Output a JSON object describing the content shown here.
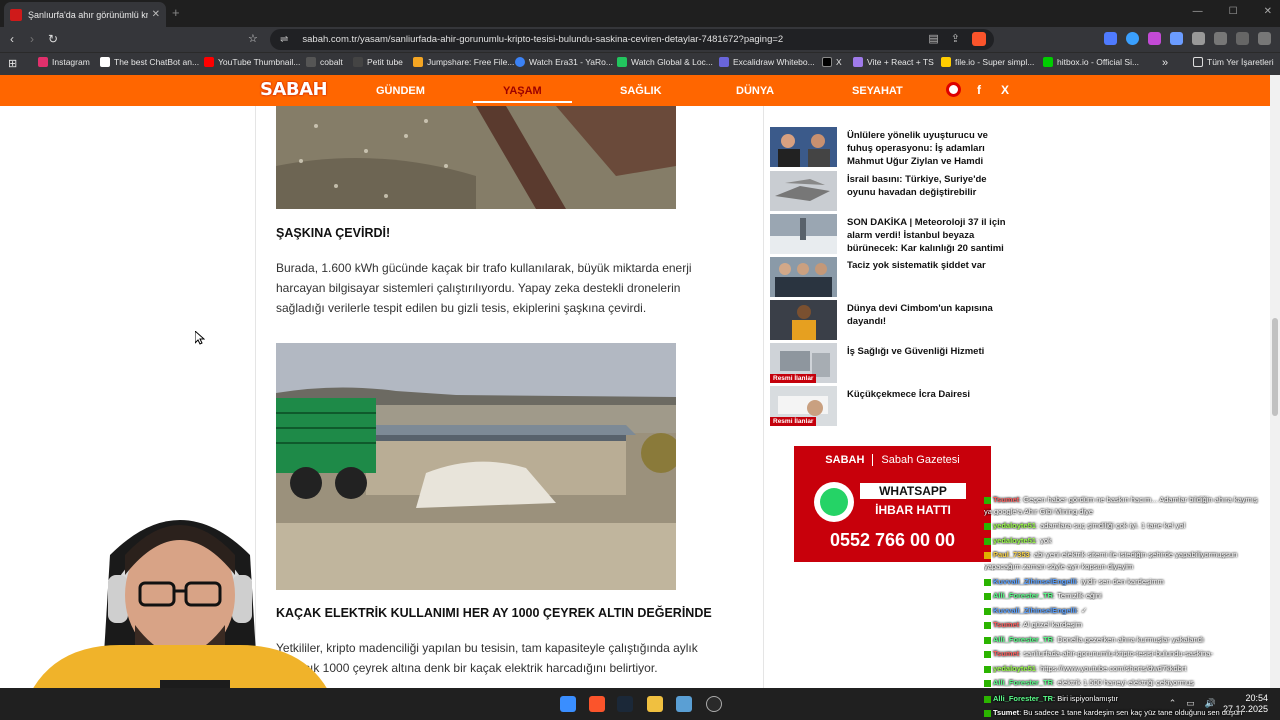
{
  "browser": {
    "tab_title": "Şanlıurfa'da ahır görünümlü kripto",
    "new_tab": "+",
    "url": "sabah.com.tr/yasam/sanliurfada-ahir-gorunumlu-kripto-tesisi-bulundu-saskina-ceviren-detaylar-7481672?paging=2",
    "bookmarks": [
      {
        "label": "Instagram",
        "color": "#e1306c"
      },
      {
        "label": "The best ChatBot an...",
        "color": "#ffffff"
      },
      {
        "label": "YouTube Thumbnail...",
        "color": "#ff0000"
      },
      {
        "label": "cobalt",
        "color": "#444444"
      },
      {
        "label": "Petit tube",
        "color": "#333333"
      },
      {
        "label": "Jumpshare: Free File...",
        "color": "#f5a623"
      },
      {
        "label": "Watch Era31 - YaRo...",
        "color": "#3b82f6"
      },
      {
        "label": "Watch Global & Loc...",
        "color": "#22c55e"
      },
      {
        "label": "Excalidraw Whitebo...",
        "color": "#6965db"
      },
      {
        "label": "X",
        "color": "#000000"
      },
      {
        "label": "Vite + React + TS",
        "color": "#9f7aea"
      },
      {
        "label": "file.io - Super simpl...",
        "color": "#ffcc00"
      },
      {
        "label": "hitbox.io - Official Si...",
        "color": "#222222"
      }
    ],
    "bookmarks_more": "»",
    "all_bookmarks": "Tüm Yer İşaretleri"
  },
  "site": {
    "logo": "SABAH",
    "nav": [
      "GÜNDEM",
      "YAŞAM",
      "SAĞLIK",
      "DÜNYA",
      "SEYAHAT"
    ],
    "active_nav": "YAŞAM",
    "social": [
      "f",
      "X"
    ]
  },
  "article": {
    "heading1": "ŞAŞKINA ÇEVİRDİ!",
    "paragraph1": "Burada, 1.600 kWh gücünde kaçak bir trafo kullanılarak, büyük miktarda enerji harcayan bilgisayar sistemleri çalıştırılıyordu. Yapay zeka destekli dronelerin sağladığı verilerle tespit edilen bu gizli tesis, ekiplerini şaşkına çevirdi.",
    "heading2": "KAÇAK ELEKTRİK KULLANIMI HER AY 1000 ÇEYREK ALTIN DEĞERİNDE",
    "paragraph2": "Yetkililer, kripto madenciliği yapılan bu tesisin, tam kapasiteyle çalıştığında aylık yaklaşık 1000 çeyrek altına denk bir kaçak elektrik harcadığını belirtiyor."
  },
  "sidebar": {
    "items": [
      {
        "title": "Ünlülere yönelik uyuşturucu ve fuhuş operasyonu: İş adamları Mahmut Uğur Ziylan ve Hamdi",
        "badge": ""
      },
      {
        "title": "İsrail basını: Türkiye, Suriye'de oyunu havadan değiştirebilir",
        "badge": ""
      },
      {
        "title": "SON DAKİKA | Meteoroloji 37 il için alarm verdi! İstanbul beyaza bürünecek: Kar kalınlığı 20 santimi",
        "badge": ""
      },
      {
        "title": "Taciz yok sistematik şiddet var",
        "badge": ""
      },
      {
        "title": "Dünya devi Cimbom'un kapısına dayandı!",
        "badge": ""
      },
      {
        "title": "İş Sağlığı ve Güvenliği Hizmeti",
        "badge": "Resmi İlanlar"
      },
      {
        "title": "Küçükçekmece İcra Dairesi",
        "badge": "Resmi İlanlar"
      }
    ]
  },
  "ad": {
    "brand": "SABAH",
    "name": "Sabah Gazetesi",
    "line1": "WHATSAPP",
    "line2": "İHBAR HATTI",
    "phone": "0552 766 00 00"
  },
  "chat": [
    {
      "user": "Tsumet",
      "msg": ": Geçen haber gördüm ne baskın hacım... Adamlar bildiğin ahıra kaymış"
    },
    {
      "user": "",
      "msg": "ya google'a Ahır Gibi Mining diye"
    },
    {
      "user": "yedaloyte51",
      "msg": ": adamlara suç şimdiliği çok iyi. 1 tane kel yol"
    },
    {
      "user": "yedaloyte51",
      "msg": ": yok"
    },
    {
      "user": "Paul_7353",
      "msg": ": abi yeni elektrik sitemi ile istediğin şehirde yapabiliyormuşsun"
    },
    {
      "user": "",
      "msg": "yapacağım zaman söyle ayrı kopsun diyeyim"
    },
    {
      "user": "Kuvvali_ZihinselEngelli",
      "msg": ": iyidir sen den kardeşimm"
    },
    {
      "user": "Alli_Forester_TR",
      "msg": ": Temizlik eğini"
    },
    {
      "user": "Kuvvali_ZihinselEngelli",
      "msg": ": ✓"
    },
    {
      "user": "Tsumet",
      "msg": ": Al güzel kardeşim"
    },
    {
      "user": "Alli_Forester_TR",
      "msg": ": Donella gezerken ahıra kurmuşlar yakalandı"
    },
    {
      "user": "Tsumet",
      "msg": ": sanliurfada-ahir-gorunumlu-kripto-tesisi-bulundu-saskina-"
    },
    {
      "user": "yedaloyte51",
      "msg": ": https://www.youtube.com/shorts/dwd7kkdbrt"
    },
    {
      "user": "Alli_Forester_TR",
      "msg": ": elektrik 1.500 haneyi elektriği çekiyormuş"
    },
    {
      "user": "Alli_Forester_TR",
      "msg": ": Biri ispiyonlamıştır"
    },
    {
      "user": "Tsumet",
      "msg": ": Bu sadece 1 tane kardeşim sen kaç yüz tane olduğunu sen düşün"
    }
  ],
  "taskbar": {
    "time": "20:54",
    "date": "27.12.2025"
  }
}
